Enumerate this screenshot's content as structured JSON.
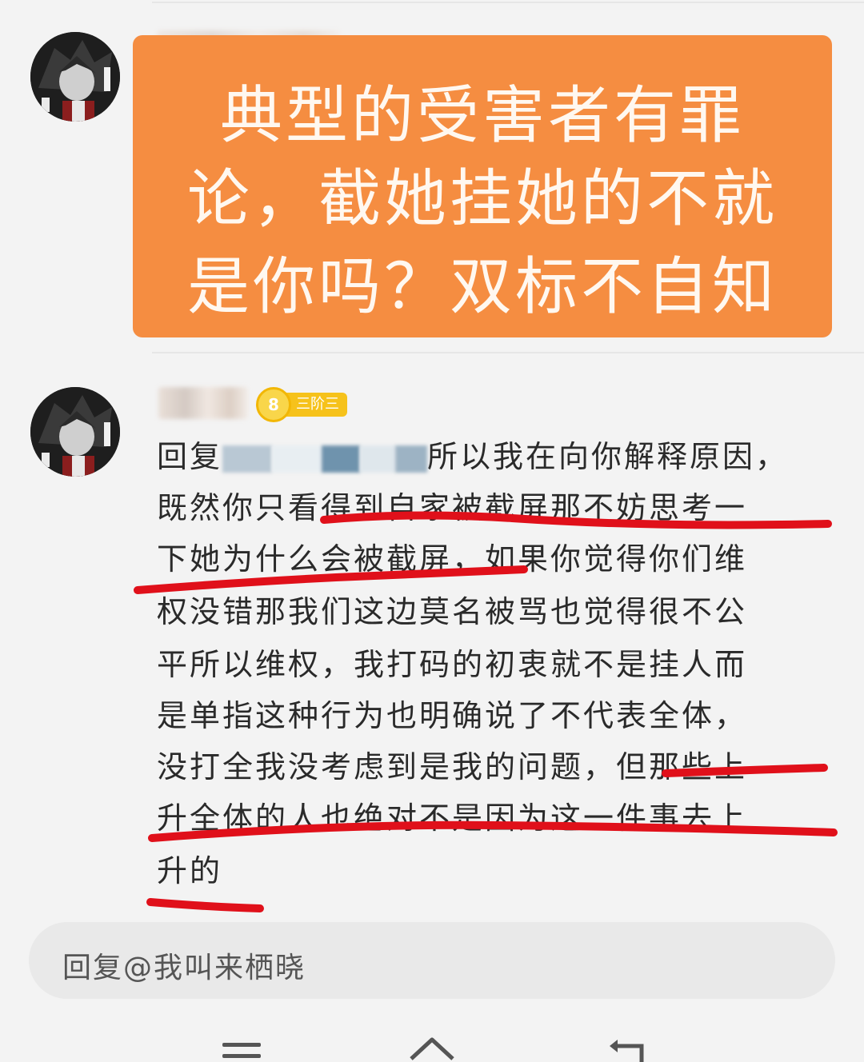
{
  "post_image": {
    "lines": [
      "典型的受害者有罪",
      "论，截她挂她的不就",
      "是你吗？双标不自知"
    ],
    "background": "#f58d41"
  },
  "comment": {
    "level": "8",
    "rank_tag": "三阶三",
    "reply_prefix": "回复",
    "reply_tail": "所以我在向你解释原因，",
    "lines": [
      "既然你只看得到自家被截屏那不妨思考一",
      "下她为什么会被截屏，如果你觉得你们维",
      "权没错那我们这边莫名被骂也觉得很不公",
      "平所以维权，我打码的初衷就不是挂人而",
      "是单指这种行为也明确说了不代表全体，",
      "没打全我没考虑到是我的问题，但那些上",
      "升全体的人也绝对不是因为这一件事去上",
      "升的"
    ],
    "annotation_color": "#e0101a"
  },
  "reply_input": {
    "placeholder": "回复@我叫来栖晓"
  },
  "icons": [
    "avatar",
    "level-badge-icon",
    "menu-icon",
    "home-icon",
    "back-icon"
  ]
}
